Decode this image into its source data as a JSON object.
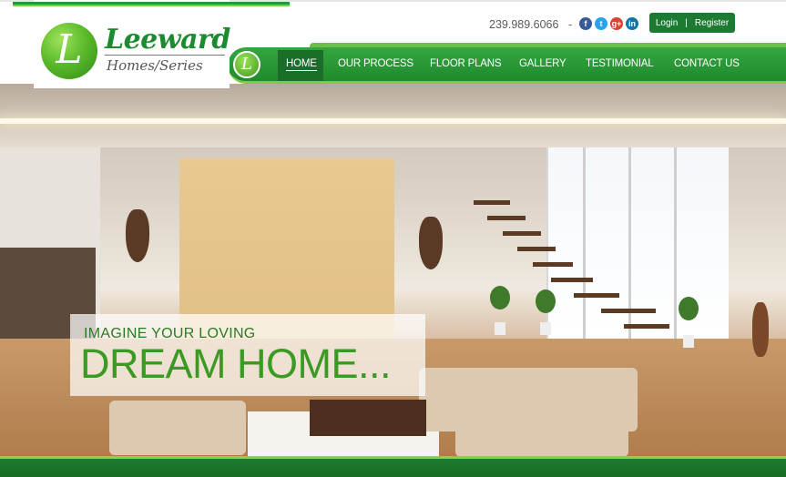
{
  "brand": {
    "logo_letter": "L",
    "name": "Leeward",
    "subtitle": "Homes/Series",
    "colors": {
      "primary": "#1d7a33",
      "accent": "#82c846",
      "text_green": "#3a9a22"
    }
  },
  "header": {
    "phone": "239.989.6066",
    "separator": "-",
    "social": [
      {
        "icon": "facebook-icon",
        "glyph": "f"
      },
      {
        "icon": "twitter-icon",
        "glyph": "t"
      },
      {
        "icon": "google-plus-icon",
        "glyph": "g+"
      },
      {
        "icon": "linkedin-icon",
        "glyph": "in"
      }
    ],
    "login_label": "Login",
    "auth_separator": "|",
    "register_label": "Register"
  },
  "nav": {
    "badge_letter": "L",
    "items": [
      {
        "label": "HOME",
        "active": true
      },
      {
        "label": "OUR PROCESS",
        "active": false
      },
      {
        "label": "FLOOR PLANS",
        "active": false
      },
      {
        "label": "GALLERY",
        "active": false
      },
      {
        "label": "TESTIMONIAL",
        "active": false
      },
      {
        "label": "CONTACT US",
        "active": false
      }
    ]
  },
  "hero": {
    "tagline_small": "IMAGINE YOUR LOVING",
    "tagline_big": "DREAM HOME..."
  }
}
